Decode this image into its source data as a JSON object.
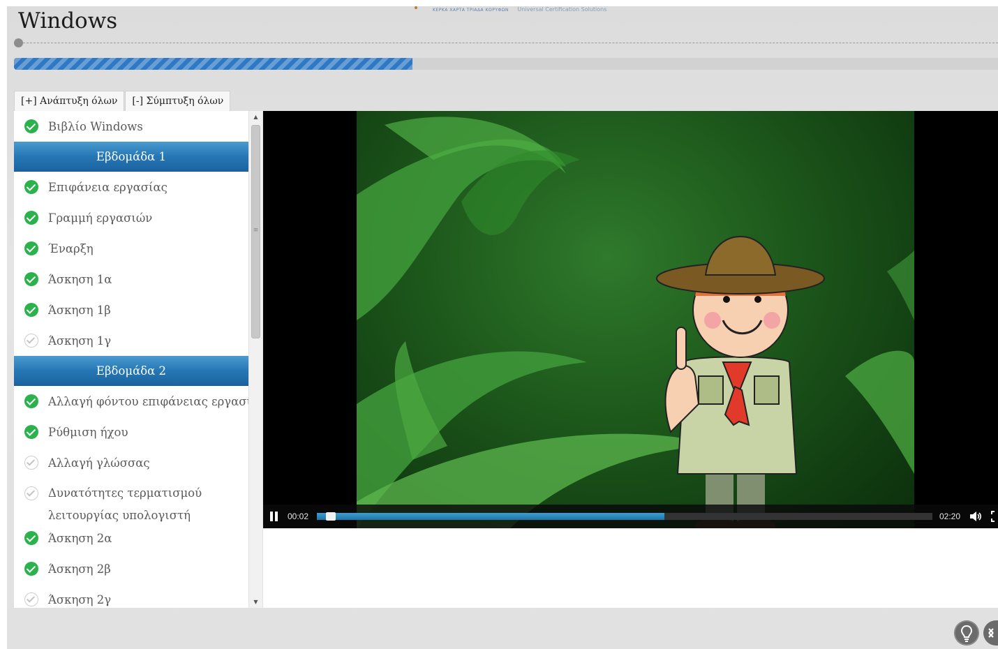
{
  "header": {
    "title": "Windows",
    "logo_text": "Universal Certification Solutions",
    "logo_tagline": "ΚΕΡΚΑ ΧΑΡΤΑ ΤΡΙΑΔΑ ΚΟΡΥΦΩΝ"
  },
  "progress": {
    "fraction": 0.405
  },
  "toolbar": {
    "expand_all": "[+] Ανάπτυξη όλων",
    "collapse_all": "[-] Σύμπτυξη όλων"
  },
  "sidebar": {
    "items": [
      {
        "type": "item",
        "label": "Βιβλίο Windows",
        "status": "done"
      },
      {
        "type": "week",
        "label": "Εβδομάδα 1"
      },
      {
        "type": "item",
        "label": "Επιφάνεια εργασίας",
        "status": "done"
      },
      {
        "type": "item",
        "label": "Γραμμή εργασιών",
        "status": "done"
      },
      {
        "type": "item",
        "label": "Έναρξη",
        "status": "done"
      },
      {
        "type": "item",
        "label": "Άσκηση 1α",
        "status": "done"
      },
      {
        "type": "item",
        "label": "Άσκηση 1β",
        "status": "done"
      },
      {
        "type": "item",
        "label": "Άσκηση 1γ",
        "status": "pending"
      },
      {
        "type": "week",
        "label": "Εβδομάδα 2"
      },
      {
        "type": "item",
        "label": "Αλλαγή φόντου επιφάνειας εργασίας",
        "status": "done"
      },
      {
        "type": "item",
        "label": "Ρύθμιση ήχου",
        "status": "done"
      },
      {
        "type": "item",
        "label": "Αλλαγή γλώσσας",
        "status": "pending"
      },
      {
        "type": "item",
        "label": "Δυνατότητες τερματισμού λειτουργίας υπολογιστή",
        "status": "pending",
        "multiline": true
      },
      {
        "type": "item",
        "label": "Άσκηση 2α",
        "status": "done"
      },
      {
        "type": "item",
        "label": "Άσκηση 2β",
        "status": "done"
      },
      {
        "type": "item",
        "label": "Άσκηση 2γ",
        "status": "pending"
      }
    ]
  },
  "video": {
    "current_time": "00:02",
    "duration": "02:20",
    "buffered_fraction": 0.565,
    "played_fraction": 0.015
  },
  "colors": {
    "accent": "#2677b5",
    "done": "#2bb24c",
    "progress": "#2e78c4"
  },
  "icons": {
    "done": "check-circle-icon",
    "pending": "pending-check-icon",
    "play_state": "pause-icon",
    "volume": "volume-icon",
    "fullscreen": "fullscreen-icon",
    "hint": "lightbulb-icon",
    "expand": "expand-icon"
  }
}
